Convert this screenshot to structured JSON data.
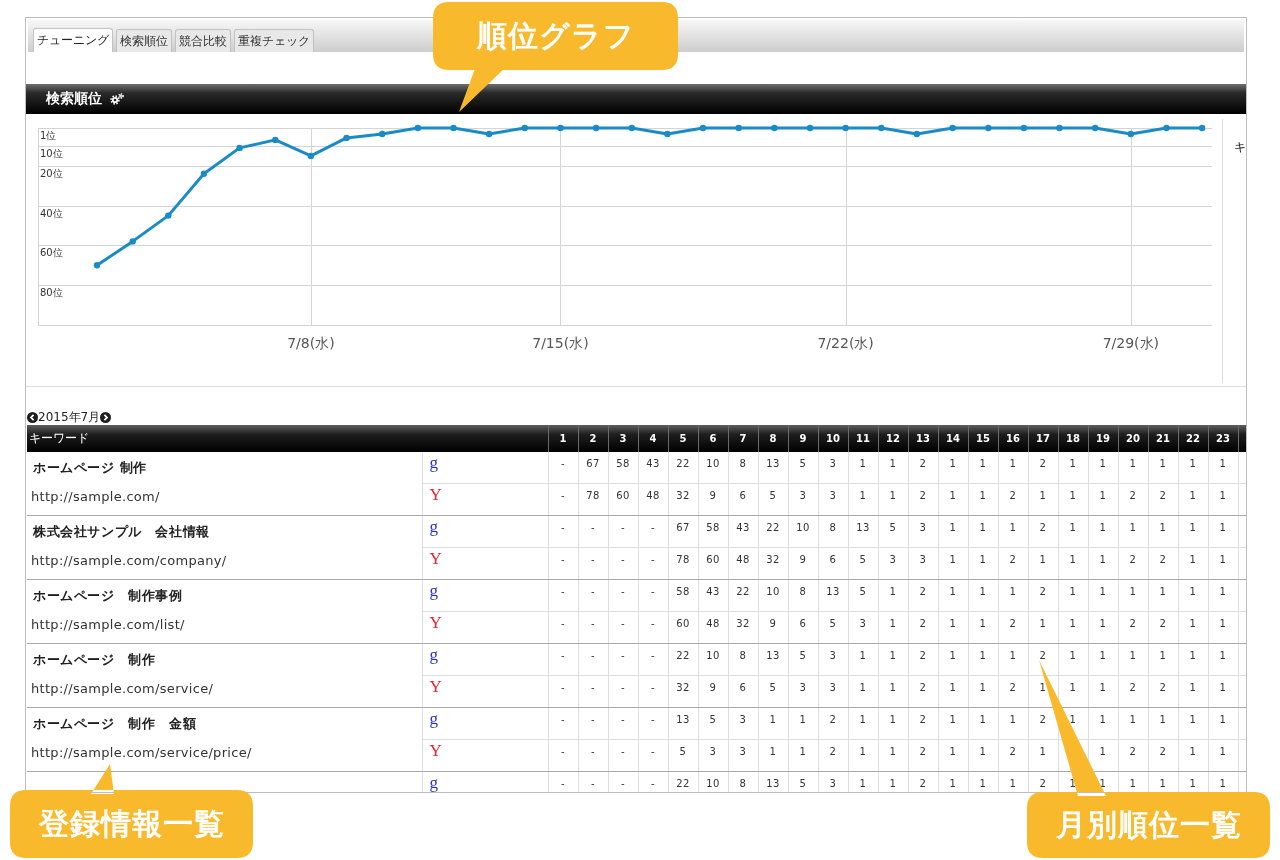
{
  "tabs": [
    {
      "label": "チューニング",
      "selected": true
    },
    {
      "label": "検索順位",
      "selected": false
    },
    {
      "label": "競合比較",
      "selected": false
    },
    {
      "label": "重複チェック",
      "selected": false
    }
  ],
  "panel": {
    "title": "検索順位"
  },
  "chart": {
    "chart_data": {
      "type": "line",
      "grid": true,
      "categories": [
        null,
        null,
        null,
        null,
        null,
        null,
        "7/8(水)",
        null,
        null,
        null,
        null,
        null,
        null,
        "7/15(水)",
        null,
        null,
        null,
        null,
        null,
        null,
        null,
        "7/22(水)",
        null,
        null,
        null,
        null,
        null,
        null,
        null,
        "7/29(水)",
        null,
        null
      ],
      "series": [
        {
          "color": "#1a8bc4",
          "marker": "circle",
          "values": [
            70,
            58,
            45,
            24,
            11,
            7,
            15,
            6,
            4,
            1,
            1,
            4,
            1,
            1,
            1,
            1,
            4,
            1,
            1,
            1,
            1,
            1,
            1,
            4,
            1,
            1,
            1,
            1,
            1,
            4,
            1,
            1
          ]
        }
      ],
      "ylim": [
        100,
        1
      ],
      "yticks": [
        {
          "value": 1,
          "label": "1位"
        },
        {
          "value": 10,
          "label": "10位"
        },
        {
          "value": 20,
          "label": "20位"
        },
        {
          "value": 40,
          "label": "40位"
        },
        {
          "value": 60,
          "label": "60位"
        },
        {
          "value": 80,
          "label": "80位"
        }
      ]
    }
  },
  "side_panel": {
    "text": "キ"
  },
  "month_nav": {
    "label": "2015年7月"
  },
  "table": {
    "columns": [
      "キーワード",
      "1",
      "2",
      "3",
      "4",
      "5",
      "6",
      "7",
      "8",
      "9",
      "10",
      "11",
      "12",
      "13",
      "14",
      "15",
      "16",
      "17",
      "18",
      "19",
      "20",
      "21",
      "22",
      "23"
    ],
    "rows": [
      {
        "keyword": "ホームページ 制作",
        "url": "http://sample.com/",
        "ranks": [
          {
            "engine": "g",
            "color": "#2b33c9",
            "values": [
              "-",
              "67",
              "58",
              "43",
              "22",
              "10",
              "8",
              "13",
              "5",
              "3",
              "1",
              "1",
              "2",
              "1",
              "1",
              "1",
              "2",
              "1",
              "1",
              "1",
              "1",
              "1",
              "1"
            ]
          },
          {
            "engine": "Y",
            "color": "#e0242b",
            "values": [
              "-",
              "78",
              "60",
              "48",
              "32",
              "9",
              "6",
              "5",
              "3",
              "3",
              "1",
              "1",
              "2",
              "1",
              "1",
              "2",
              "1",
              "1",
              "1",
              "2",
              "2",
              "1",
              "1"
            ]
          }
        ]
      },
      {
        "keyword": "株式会社サンプル　会社情報",
        "url": "http://sample.com/company/",
        "ranks": [
          {
            "engine": "g",
            "color": "#2b33c9",
            "values": [
              "-",
              "-",
              "-",
              "-",
              "67",
              "58",
              "43",
              "22",
              "10",
              "8",
              "13",
              "5",
              "3",
              "1",
              "1",
              "1",
              "2",
              "1",
              "1",
              "1",
              "1",
              "1",
              "1"
            ]
          },
          {
            "engine": "Y",
            "color": "#e0242b",
            "values": [
              "-",
              "-",
              "-",
              "-",
              "78",
              "60",
              "48",
              "32",
              "9",
              "6",
              "5",
              "3",
              "3",
              "1",
              "1",
              "2",
              "1",
              "1",
              "1",
              "2",
              "2",
              "1",
              "1"
            ]
          }
        ]
      },
      {
        "keyword": "ホームページ　制作事例",
        "url": "http://sample.com/list/",
        "ranks": [
          {
            "engine": "g",
            "color": "#2b33c9",
            "values": [
              "-",
              "-",
              "-",
              "-",
              "58",
              "43",
              "22",
              "10",
              "8",
              "13",
              "5",
              "1",
              "2",
              "1",
              "1",
              "1",
              "2",
              "1",
              "1",
              "1",
              "1",
              "1",
              "1"
            ]
          },
          {
            "engine": "Y",
            "color": "#e0242b",
            "values": [
              "-",
              "-",
              "-",
              "-",
              "60",
              "48",
              "32",
              "9",
              "6",
              "5",
              "3",
              "1",
              "2",
              "1",
              "1",
              "2",
              "1",
              "1",
              "1",
              "2",
              "2",
              "1",
              "1"
            ]
          }
        ]
      },
      {
        "keyword": "ホームページ　制作",
        "url": "http://sample.com/service/",
        "ranks": [
          {
            "engine": "g",
            "color": "#2b33c9",
            "values": [
              "-",
              "-",
              "-",
              "-",
              "22",
              "10",
              "8",
              "13",
              "5",
              "3",
              "1",
              "1",
              "2",
              "1",
              "1",
              "1",
              "2",
              "1",
              "1",
              "1",
              "1",
              "1",
              "1"
            ]
          },
          {
            "engine": "Y",
            "color": "#e0242b",
            "values": [
              "-",
              "-",
              "-",
              "-",
              "32",
              "9",
              "6",
              "5",
              "3",
              "3",
              "1",
              "1",
              "2",
              "1",
              "1",
              "2",
              "1",
              "1",
              "1",
              "2",
              "2",
              "1",
              "1"
            ]
          }
        ]
      },
      {
        "keyword": "ホームページ　制作　金額",
        "url": "http://sample.com/service/price/",
        "ranks": [
          {
            "engine": "g",
            "color": "#2b33c9",
            "values": [
              "-",
              "-",
              "-",
              "-",
              "13",
              "5",
              "3",
              "1",
              "1",
              "2",
              "1",
              "1",
              "2",
              "1",
              "1",
              "1",
              "2",
              "1",
              "1",
              "1",
              "1",
              "1",
              "1"
            ]
          },
          {
            "engine": "Y",
            "color": "#e0242b",
            "values": {
              "01": "-",
              "02": "-",
              "03": "-",
              "04": "-",
              "05": "5",
              "06": "3",
              "07": "3",
              "08": "1",
              "09": "1",
              "10": "2",
              "11": "1",
              "12": "1",
              "13": "2",
              "14": "1",
              "15": "1",
              "16": "2",
              "17": "1",
              "19": "1",
              "20": "2",
              "21": "2",
              "22": "1",
              "23": "1"
            }
          }
        ]
      },
      {
        "ranks": [
          {
            "engine": "g",
            "color": "#2b33c9",
            "values": [
              "-",
              "-",
              "-",
              "-",
              "22",
              "10",
              "8",
              "13",
              "5",
              "3",
              "1",
              "1",
              "2",
              "1",
              "1",
              "1",
              "2",
              "1",
              "1",
              "1",
              "1",
              "1",
              "1"
            ]
          }
        ]
      }
    ]
  },
  "callouts": [
    {
      "text": "順位グラフ"
    },
    {
      "text": "登録情報一覧"
    },
    {
      "text": "月別順位一覧"
    }
  ]
}
